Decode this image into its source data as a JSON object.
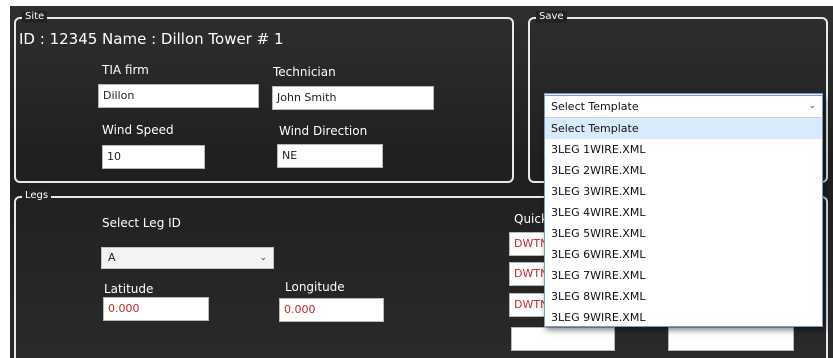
{
  "site": {
    "legend": "Site",
    "title": "ID : 12345  Name : Dillon Tower # 1",
    "tia_firm_label": "TIA firm",
    "tia_firm_value": "Dillon",
    "technician_label": "Technician",
    "technician_value": "John Smith",
    "wind_speed_label": "Wind Speed",
    "wind_speed_value": "10",
    "wind_direction_label": "Wind Direction",
    "wind_direction_value": "NE"
  },
  "save": {
    "legend": "Save",
    "select_template_value": "Select Template",
    "options": [
      "Select Template",
      "3LEG 1WIRE.XML",
      "3LEG 2WIRE.XML",
      "3LEG 3WIRE.XML",
      "3LEG 4WIRE.XML",
      "3LEG 5WIRE.XML",
      "3LEG 6WIRE.XML",
      "3LEG 7WIRE.XML",
      "3LEG 8WIRE.XML",
      "3LEG 9WIRE.XML"
    ]
  },
  "legs": {
    "legend": "Legs",
    "select_leg_label": "Select Leg ID",
    "select_leg_value": "A",
    "latitude_label": "Latitude",
    "latitude_value": "0.000",
    "longitude_label": "Longitude",
    "longitude_value": "0.000",
    "quick_label": "Quick",
    "quick_values": [
      "DWTN",
      "DWTN",
      "DWTN"
    ]
  }
}
